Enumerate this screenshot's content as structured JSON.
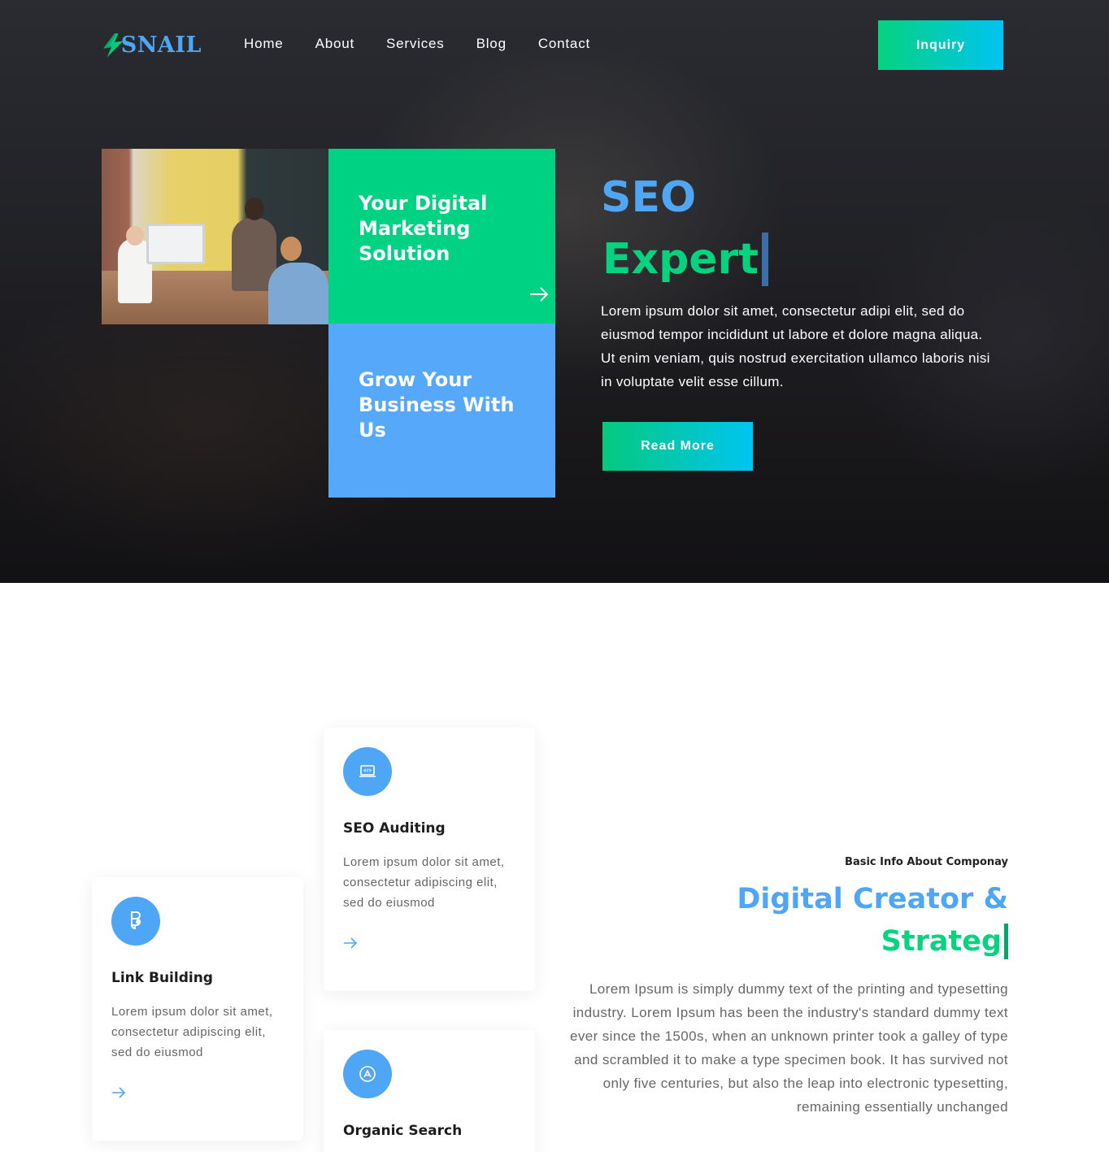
{
  "brand": {
    "name": "SNAIL"
  },
  "nav": {
    "items": [
      {
        "label": "Home"
      },
      {
        "label": "About"
      },
      {
        "label": "Services"
      },
      {
        "label": "Blog"
      },
      {
        "label": "Contact"
      }
    ],
    "inquiry_label": "Inquiry"
  },
  "hero": {
    "tile_green_title": "Your Digital Marketing Solution",
    "tile_blue_title": "Grow Your Business With Us",
    "word1": "SEO",
    "word2": "Expert",
    "text": "Lorem ipsum dolor sit amet, consectetur adipi elit, sed do eiusmod tempor incididunt ut labore et dolore magna aliqua. Ut enim veniam, quis nostrud exercitation ullamco laboris nisi in voluptate velit esse cillum.",
    "button_label": "Read More"
  },
  "services": [
    {
      "title": "Link Building",
      "text": "Lorem ipsum dolor sit amet, consectetur adipiscing elit, sed do eiusmod",
      "icon": "figma-icon"
    },
    {
      "title": "SEO Auditing",
      "text": "Lorem ipsum dolor sit amet, consectetur adipiscing elit, sed do eiusmod",
      "icon": "laptop-code-icon"
    },
    {
      "title": "Organic Search",
      "text": "",
      "icon": "app-store-icon"
    }
  ],
  "about": {
    "kicker": "Basic Info About Componay",
    "line1": "Digital Creator &",
    "line2": "Strateg",
    "text": "Lorem Ipsum is simply dummy text of the printing and typesetting industry. Lorem Ipsum has been the industry's standard dummy text ever since the 1500s, when an unknown printer took a galley of type and scrambled it to make a type specimen book. It has survived not only five centuries, but also the leap into electronic typesetting, remaining essentially unchanged"
  },
  "colors": {
    "brand_blue": "#4ea6f5",
    "brand_green": "#05d37f",
    "gradient_end": "#00c3f2"
  }
}
